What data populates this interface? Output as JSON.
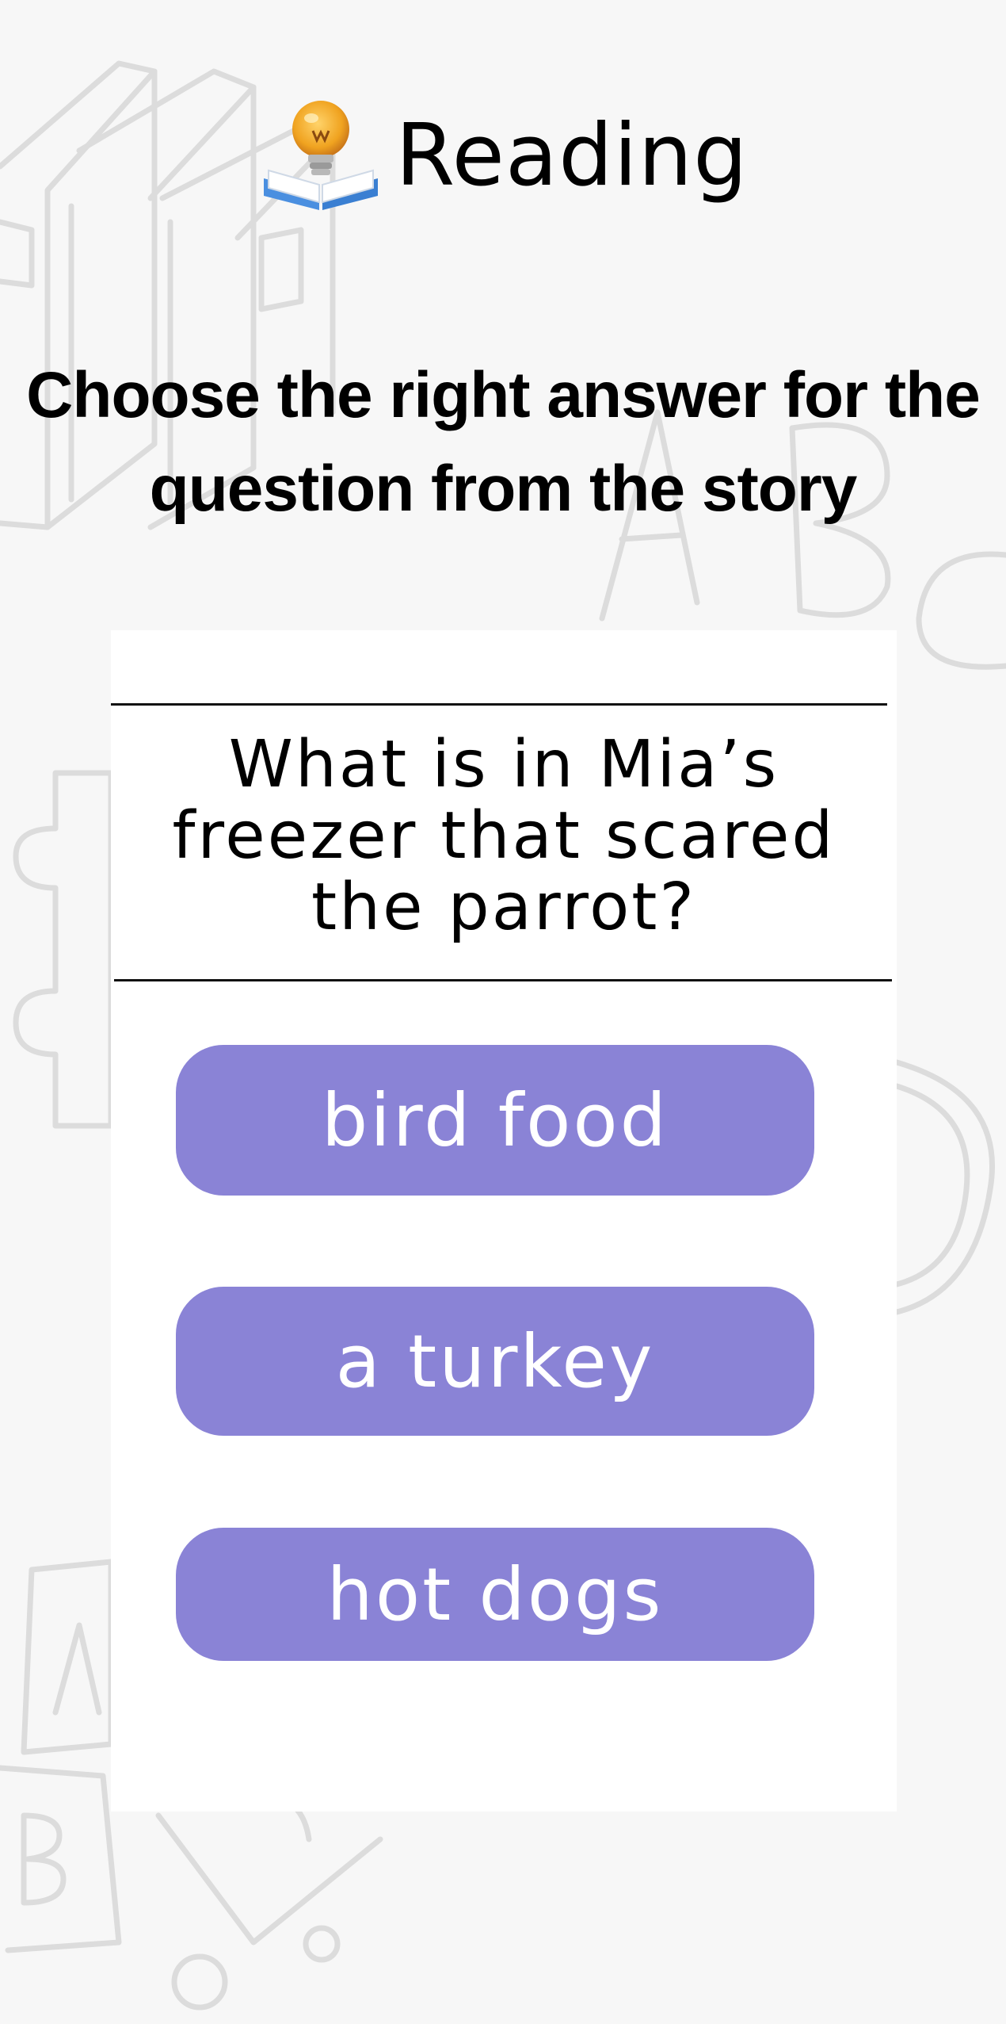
{
  "header": {
    "icon": "lightbulb-book-icon",
    "title": "Reading"
  },
  "instruction": {
    "line1": "Choose the right answer for the",
    "line2": "question from the story"
  },
  "question": {
    "line1": "What is in Mia’s",
    "line2": "freezer that scared",
    "line3": "the parrot?"
  },
  "options": [
    {
      "label": "bird food"
    },
    {
      "label": "a turkey"
    },
    {
      "label": "hot dogs"
    }
  ],
  "colors": {
    "background": "#f7f7f7",
    "card": "#ffffff",
    "option_button": "#8a83d6",
    "option_text": "#ffffff",
    "doodle_stroke": "#dcdcdc"
  }
}
